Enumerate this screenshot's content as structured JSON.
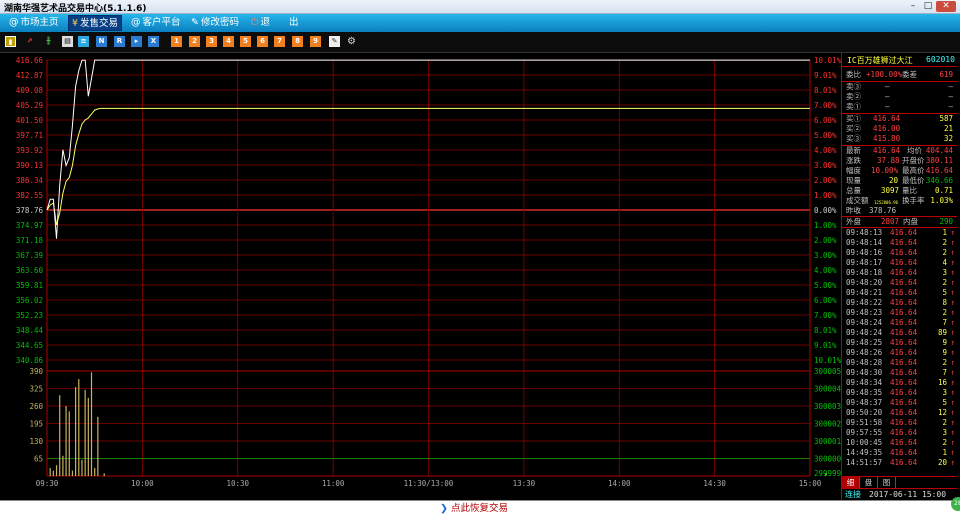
{
  "window": {
    "title": "湖南华强艺术品交易中心(5.1.1.6)"
  },
  "menu": [
    {
      "label": "市场主页",
      "icon": "@"
    },
    {
      "label": "发售交易",
      "icon": "¥"
    },
    {
      "label": "客户平台",
      "icon": "@"
    },
    {
      "label": "修改密码",
      "icon": "✎"
    },
    {
      "label": "退",
      "icon": "⏻"
    },
    {
      "label": "出",
      "icon": ""
    }
  ],
  "toolbar_icons": [
    "bar-chart-icon",
    "line-chart-icon",
    "candle-chart-icon",
    "calendar-icon",
    "list-icon",
    "news-icon",
    "report-icon",
    "forward-icon",
    "x-icon",
    "doc-icon-1",
    "doc-icon-2",
    "doc-icon-3",
    "doc-icon-4",
    "doc-icon-5",
    "doc-icon-6",
    "doc-icon-7",
    "doc-icon-8",
    "doc-icon-9",
    "pencil-icon",
    "gear-icon"
  ],
  "stock": {
    "name": "IC百万雄狮过大江",
    "code": "602010"
  },
  "order_book": {
    "ratio_label": "委比",
    "ratio": "+100.00%",
    "diff_label": "委差",
    "diff": "619",
    "sells": [
      {
        "label": "卖③",
        "price": "—",
        "vol": "—"
      },
      {
        "label": "卖②",
        "price": "—",
        "vol": "—"
      },
      {
        "label": "卖①",
        "price": "—",
        "vol": "—"
      }
    ],
    "buys": [
      {
        "label": "买①",
        "price": "416.64",
        "vol": "587"
      },
      {
        "label": "买②",
        "price": "416.00",
        "vol": "21"
      },
      {
        "label": "买③",
        "price": "415.80",
        "vol": "32"
      }
    ]
  },
  "quote": {
    "last_l": "最新",
    "last": "416.64",
    "avg_l": "均价",
    "avg": "404.44",
    "chg_l": "涨跌",
    "chg": "37.88",
    "open_l": "开盘价",
    "open": "380.11",
    "pct_l": "幅度",
    "pct": "10.00%",
    "high_l": "最高价",
    "high": "416.64",
    "cur_l": "现量",
    "cur": "20",
    "low_l": "最低价",
    "low": "346.66",
    "total_l": "总量",
    "total": "3097",
    "vr_l": "量比",
    "vr": "0.71",
    "amt_l": "成交额",
    "amt": "1252806.96",
    "turn_l": "换手率",
    "turn": "1.03%",
    "prev_l": "昨收",
    "prev": "378.76",
    "outer_l": "外盘",
    "outer": "2807",
    "inner_l": "内盘",
    "inner": "290"
  },
  "ticks": [
    {
      "t": "09:48:13",
      "p": "416.64",
      "v": "1"
    },
    {
      "t": "09:48:14",
      "p": "416.64",
      "v": "2"
    },
    {
      "t": "09:48:16",
      "p": "416.64",
      "v": "2"
    },
    {
      "t": "09:48:17",
      "p": "416.64",
      "v": "4"
    },
    {
      "t": "09:48:18",
      "p": "416.64",
      "v": "3"
    },
    {
      "t": "09:48:20",
      "p": "416.64",
      "v": "2"
    },
    {
      "t": "09:48:21",
      "p": "416.64",
      "v": "5"
    },
    {
      "t": "09:48:22",
      "p": "416.64",
      "v": "8"
    },
    {
      "t": "09:48:23",
      "p": "416.64",
      "v": "2"
    },
    {
      "t": "09:48:24",
      "p": "416.64",
      "v": "7"
    },
    {
      "t": "09:48:24",
      "p": "416.64",
      "v": "89"
    },
    {
      "t": "09:48:25",
      "p": "416.64",
      "v": "9"
    },
    {
      "t": "09:48:26",
      "p": "416.64",
      "v": "9"
    },
    {
      "t": "09:48:28",
      "p": "416.64",
      "v": "2"
    },
    {
      "t": "09:48:30",
      "p": "416.64",
      "v": "7"
    },
    {
      "t": "09:48:34",
      "p": "416.64",
      "v": "16"
    },
    {
      "t": "09:48:35",
      "p": "416.64",
      "v": "3"
    },
    {
      "t": "09:48:37",
      "p": "416.64",
      "v": "5"
    },
    {
      "t": "09:50:20",
      "p": "416.64",
      "v": "12"
    },
    {
      "t": "09:51:58",
      "p": "416.64",
      "v": "2"
    },
    {
      "t": "09:57:55",
      "p": "416.64",
      "v": "3"
    },
    {
      "t": "10:00:45",
      "p": "416.64",
      "v": "2"
    },
    {
      "t": "14:49:35",
      "p": "416.64",
      "v": "1"
    },
    {
      "t": "14:51:57",
      "p": "416.64",
      "v": "20"
    }
  ],
  "panel_tabs": [
    "细",
    "盘",
    "图"
  ],
  "status": {
    "connection": "连接",
    "datetime": "2017-06-11 15:00"
  },
  "bottom": {
    "resume_text": "点此恢复交易"
  },
  "circle_badge": "28",
  "colors": {
    "up": "#ff3030",
    "down": "#00c000",
    "grid": "#8b0000",
    "price_line": "#ffffff",
    "avg_line": "#ffff66",
    "volume": "#c8b45a"
  },
  "chart_data": {
    "type": "line",
    "price_axis_labels": [
      "416.66",
      "412.87",
      "409.08",
      "405.29",
      "401.50",
      "397.71",
      "393.92",
      "390.13",
      "386.34",
      "382.55",
      "378.76",
      "374.97",
      "371.18",
      "367.39",
      "363.60",
      "359.81",
      "356.02",
      "352.23",
      "348.44",
      "344.65",
      "340.86"
    ],
    "pct_axis_labels": [
      "10.01%",
      "9.01%",
      "8.01%",
      "7.00%",
      "6.00%",
      "5.00%",
      "4.00%",
      "3.00%",
      "2.00%",
      "1.00%",
      "0.00%",
      "1.00%",
      "2.00%",
      "3.00%",
      "4.00%",
      "5.00%",
      "6.00%",
      "7.00%",
      "8.01%",
      "9.01%",
      "10.01%"
    ],
    "volume_axis_labels": [
      "390",
      "325",
      "260",
      "195",
      "130",
      "65",
      ""
    ],
    "volume_right_labels": [
      "300005",
      "300004",
      "300003",
      "300002",
      "300001",
      "300000",
      "299999"
    ],
    "time_labels": [
      "09:30",
      "10:00",
      "10:30",
      "11:00",
      "11:30/13:00",
      "13:30",
      "14:00",
      "14:30",
      "15:00"
    ],
    "preclose": 378.76,
    "y_range": [
      340.86,
      416.66
    ],
    "price_series": {
      "name": "price",
      "x": [
        0,
        1,
        2,
        3,
        4,
        5,
        6,
        7,
        8,
        9,
        10,
        11,
        12,
        13,
        14,
        15,
        16,
        17,
        18,
        19,
        240
      ],
      "values": [
        378.76,
        381.5,
        381.5,
        371.5,
        385,
        394,
        390,
        392,
        400,
        410,
        414,
        416.6,
        416.6,
        407.5,
        412,
        416.64,
        416.64,
        416.64,
        416.64,
        416.64,
        416.64
      ]
    },
    "avg_series": {
      "name": "avg",
      "x": [
        0,
        1,
        2,
        3,
        4,
        5,
        6,
        7,
        8,
        9,
        10,
        11,
        12,
        13,
        14,
        15,
        16,
        17,
        18,
        19,
        240
      ],
      "values": [
        378.76,
        380,
        380.5,
        375,
        378,
        383,
        386,
        387,
        390,
        395,
        398,
        400.5,
        401.5,
        402,
        403,
        404,
        404.3,
        404.44,
        404.44,
        404.44,
        404.44
      ]
    },
    "volume": {
      "x": [
        1,
        2,
        3,
        4,
        5,
        6,
        7,
        8,
        9,
        10,
        11,
        12,
        13,
        14,
        15,
        16,
        18,
        245
      ],
      "values": [
        30,
        20,
        40,
        300,
        75,
        260,
        240,
        20,
        330,
        360,
        60,
        320,
        290,
        385,
        30,
        220,
        10,
        10
      ]
    }
  }
}
